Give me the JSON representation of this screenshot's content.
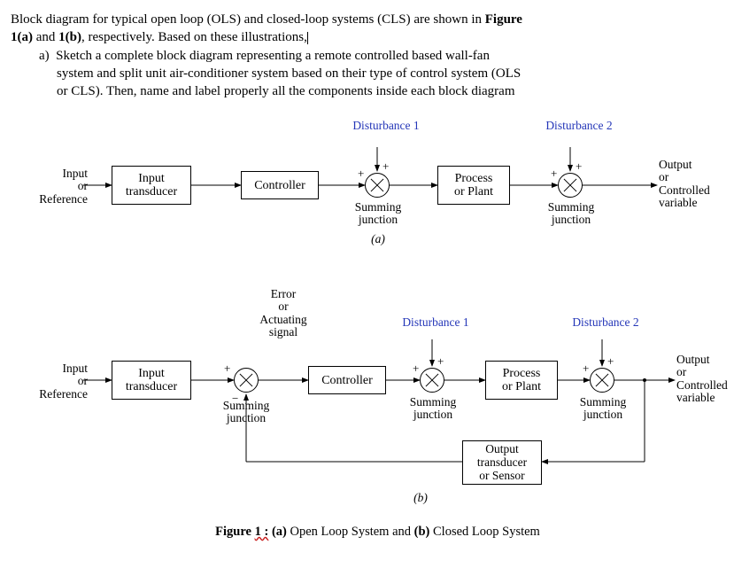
{
  "question": {
    "line1_a": "Block diagram for typical open loop (OLS) and closed-loop systems (CLS) are shown in ",
    "line1_b": "Figure",
    "line2_a": "1(a)",
    "line2_b": " and ",
    "line2_c": "1(b)",
    "line2_d": ", respectively. Based on these illustrations,",
    "a_marker": "a)",
    "a1": "Sketch a complete block diagram representing a remote controlled based wall-fan",
    "a2": "system and split unit air-conditioner system based on their type of control system (OLS",
    "a3": "or CLS). Then, name and label properly all the components inside each block diagram"
  },
  "labels": {
    "input_ref": "Input\nor\nReference",
    "input_transducer": "Input\ntransducer",
    "controller": "Controller",
    "process": "Process\nor Plant",
    "output": "Output\nor\nControlled\nvariable",
    "disturbance1": "Disturbance 1",
    "disturbance2": "Disturbance 2",
    "summing_junction": "Summing\njunction",
    "error_signal": "Error\nor\nActuating\nsignal",
    "output_sensor": "Output\ntransducer\nor Sensor",
    "sub_a": "(a)",
    "sub_b": "(b)"
  },
  "signs": {
    "plus": "+",
    "minus": "−"
  },
  "caption": {
    "fig": "Figure ",
    "one": "1 :",
    "rest_a": " (a)",
    "ols": " Open Loop System and ",
    "rest_b": "(b)",
    "cls": " Closed Loop System"
  }
}
